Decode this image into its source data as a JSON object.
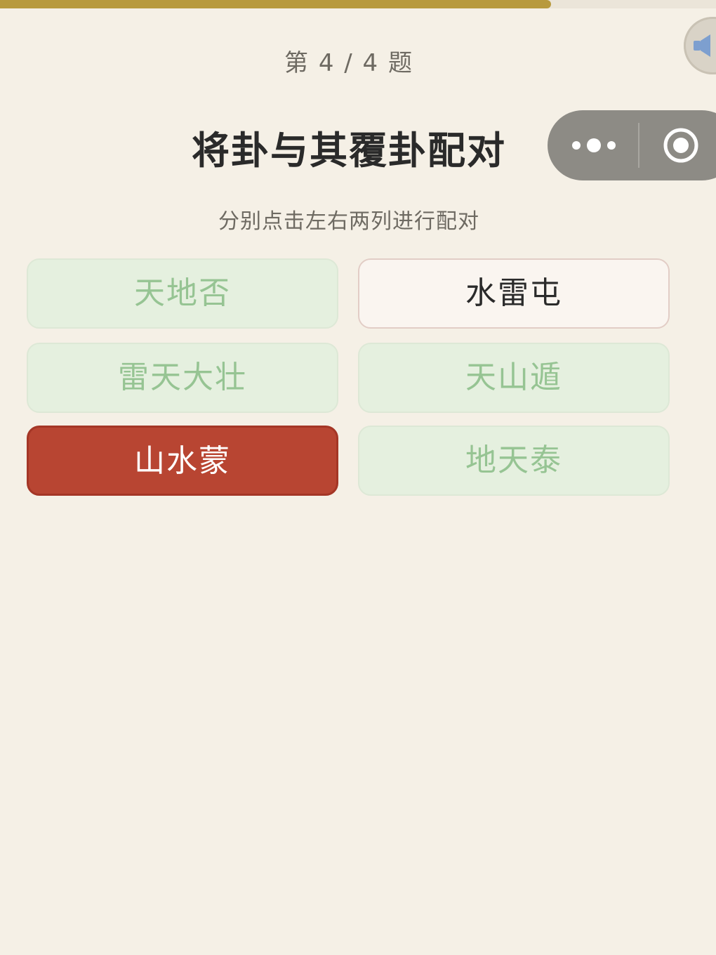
{
  "progress": {
    "fraction": 0.77
  },
  "header": {
    "counter": "第 4 / 4 题",
    "title": "将卦与其覆卦配对",
    "subtitle": "分别点击左右两列进行配对"
  },
  "left_options": [
    {
      "label": "天地否",
      "state": "matched"
    },
    {
      "label": "雷天大壮",
      "state": "matched"
    },
    {
      "label": "山水蒙",
      "state": "selected"
    }
  ],
  "right_options": [
    {
      "label": "水雷屯",
      "state": "normal"
    },
    {
      "label": "天山遁",
      "state": "matched"
    },
    {
      "label": "地天泰",
      "state": "matched"
    }
  ],
  "icons": {
    "sound": "speaker-icon",
    "more": "more-dots-icon",
    "close": "target-circle-icon"
  },
  "colors": {
    "progress": "#b89a3e",
    "matched_bg": "#e5f0df",
    "matched_text": "#96c493",
    "selected_bg": "#b84532",
    "capsule": "#8d8b85"
  }
}
